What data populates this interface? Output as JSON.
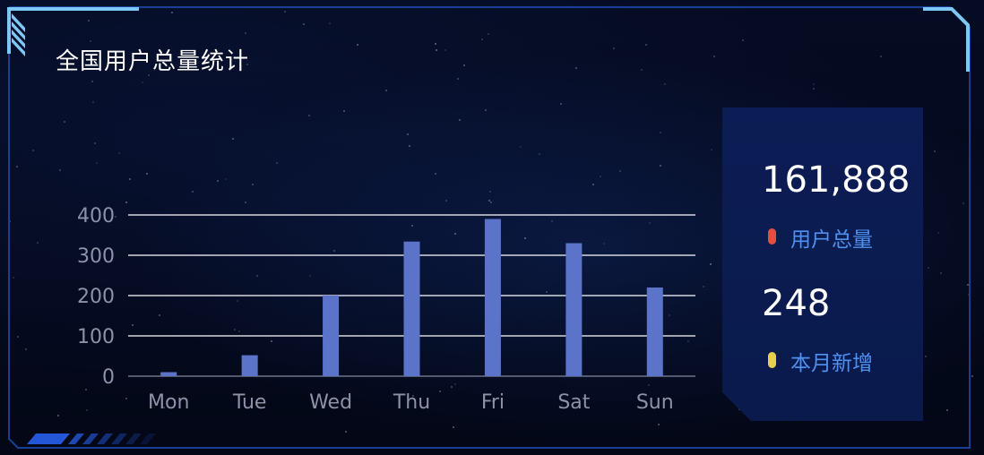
{
  "title": "全国用户总量统计",
  "stats": {
    "total_value": "161,888",
    "total_label": "用户总量",
    "total_color": "#e2503f",
    "new_value": "248",
    "new_label": "本月新增",
    "new_color": "#e7d14a"
  },
  "colors": {
    "bar": "#5b73c8",
    "grid": "#ffffff",
    "tick_text": "#8c93a8",
    "accent": "#7ec8f5"
  },
  "chart_data": {
    "type": "bar",
    "title": "全国用户总量统计",
    "xlabel": "",
    "ylabel": "",
    "categories": [
      "Mon",
      "Tue",
      "Wed",
      "Thu",
      "Fri",
      "Sat",
      "Sun"
    ],
    "values": [
      10,
      52,
      200,
      334,
      390,
      330,
      220
    ],
    "ylim": [
      0,
      400
    ],
    "yticks": [
      "0",
      "100",
      "200",
      "300",
      "400"
    ],
    "grid": true,
    "legend": "none"
  }
}
